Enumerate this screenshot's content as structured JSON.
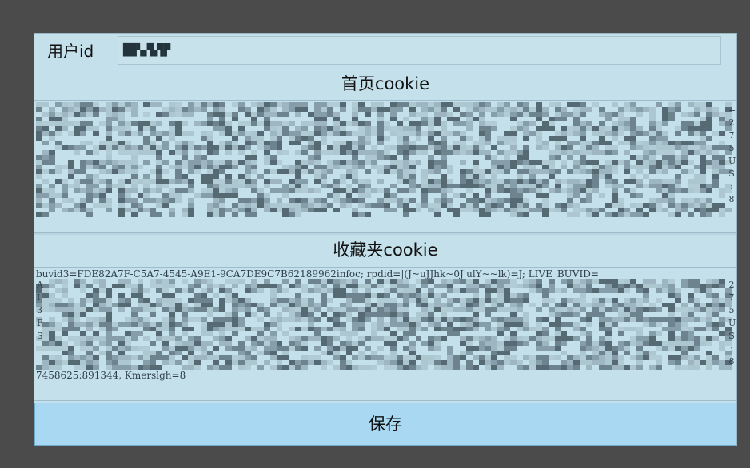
{
  "user": {
    "label": "用户id",
    "value": "██▚▞▙▜▛"
  },
  "home_cookie": {
    "title": "首页cookie",
    "text": "",
    "edge_right": [
      "=",
      "2",
      "7",
      "5",
      "U",
      "S",
      ":",
      "8"
    ]
  },
  "fav_cookie": {
    "title": "收藏夹cookie",
    "first_line": "buvid3=FDE82A7F-C5A7-4545-A9E1-9CA7DE9C7B62189962infoc; rpdid=|(J~uJJhk~0J'ulY~~lk)=J; LIVE_BUVID=",
    "last_line": "7458625:891344, Kmerslgh=8",
    "edge_left": [
      "A",
      "I",
      "3",
      "F",
      "S"
    ],
    "edge_right": [
      "2",
      "7",
      "5",
      "U",
      "S",
      ":",
      "8"
    ]
  },
  "save_button": {
    "label": "保存"
  },
  "colors": {
    "background": "#4b4b4b",
    "panel": "#c4e0ea",
    "button": "#a8d8f2"
  }
}
